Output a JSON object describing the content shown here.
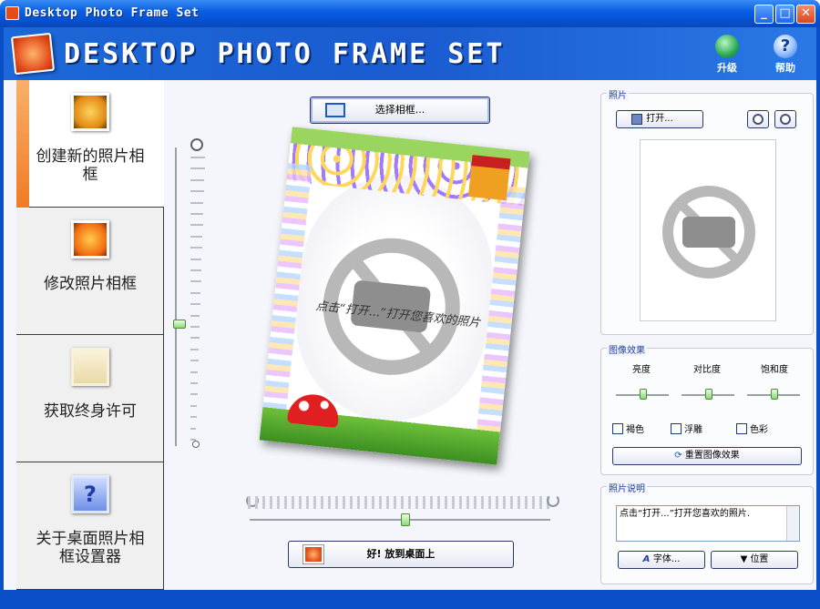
{
  "window": {
    "title": "Desktop Photo Frame Set",
    "min_glyph": "_",
    "max_glyph": "□",
    "close_glyph": "✕"
  },
  "header": {
    "app_title": "DESKTOP PHOTO FRAME SET",
    "upgrade_label": "升级",
    "help_label": "帮助",
    "help_glyph": "?"
  },
  "nav": {
    "create": "创建新的照片相框",
    "modify": "修改照片相框",
    "license": "获取终身许可",
    "about": "关于桌面照片相框设置器",
    "about_glyph": "?"
  },
  "center": {
    "select_frame_label": "选择相框...",
    "frame_prompt": "点击“打开...”打开您喜欢的照片",
    "apply_label": "好! 放到桌面上"
  },
  "photo_panel": {
    "title": "照片",
    "open_label": "打开..."
  },
  "effects_panel": {
    "title": "图像效果",
    "brightness_label": "亮度",
    "contrast_label": "对比度",
    "saturation_label": "饱和度",
    "sepia_label": "褐色",
    "emboss_label": "浮雕",
    "color_label": "色彩",
    "reset_label": "重置图像效果"
  },
  "caption_panel": {
    "title": "照片说明",
    "caption_text": "点击“打开...”打开您喜欢的照片.",
    "font_label": "字体...",
    "position_label": "位置"
  },
  "colors": {
    "titlebar": "#0a5fe0",
    "accent_orange": "#f07b24",
    "group_title": "#1e3ea8"
  }
}
